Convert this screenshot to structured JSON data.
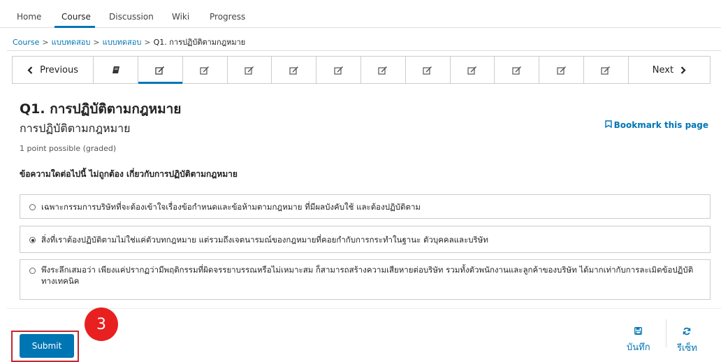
{
  "topnav": {
    "items": [
      {
        "label": "Home",
        "active": false
      },
      {
        "label": "Course",
        "active": true
      },
      {
        "label": "Discussion",
        "active": false
      },
      {
        "label": "Wiki",
        "active": false
      },
      {
        "label": "Progress",
        "active": false
      }
    ]
  },
  "breadcrumb": {
    "items": [
      "Course",
      "แบบทดสอบ",
      "แบบทดสอบ",
      "Q1. การปฏิบัติตามกฎหมาย"
    ],
    "separator": ">"
  },
  "sequence": {
    "previous_label": "Previous",
    "next_label": "Next",
    "tabs": [
      {
        "icon": "book-icon",
        "active": false
      },
      {
        "icon": "edit-icon",
        "active": true
      },
      {
        "icon": "edit-icon",
        "active": false
      },
      {
        "icon": "edit-icon",
        "active": false
      },
      {
        "icon": "edit-icon",
        "active": false
      },
      {
        "icon": "edit-icon",
        "active": false
      },
      {
        "icon": "edit-icon",
        "active": false
      },
      {
        "icon": "edit-icon",
        "active": false
      },
      {
        "icon": "edit-icon",
        "active": false
      },
      {
        "icon": "edit-icon",
        "active": false
      },
      {
        "icon": "edit-icon",
        "active": false
      },
      {
        "icon": "edit-icon",
        "active": false
      }
    ]
  },
  "problem": {
    "title": "Q1. การปฏิบัติตามกฎหมาย",
    "subtitle": "การปฏิบัติตามกฎหมาย",
    "bookmark_label": "Bookmark this page",
    "points": "1 point possible (graded)",
    "question": "ข้อความใดต่อไปนี้ ไม่ถูกต้อง เกี่ยวกับการปฏิบัติตามกฎหมาย",
    "options": [
      {
        "text": "เฉพาะกรรมการบริษัทที่จะต้องเข้าใจเรื่องข้อกำหนดและข้อห้ามตามกฎหมาย ที่มีผลบังคับใช้ และต้องปฏิบัติตาม",
        "selected": false
      },
      {
        "text": "สิ่งที่เราต้องปฏิบัติตามไม่ใช่แค่ตัวบทกฎหมาย แต่รวมถึงเจตนารมณ์ของกฎหมายที่คอยกำกับการกระทำในฐานะ ตัวบุคคลและบริษัท",
        "selected": true
      },
      {
        "text": "พึงระลึกเสมอว่า เพียงแค่ปรากฏว่ามีพฤติกรรมที่ผิดจรรยาบรรณหรือไม่เหมาะสม ก็สามารถสร้างความเสียหายต่อบริษัท รวมทั้งตัวพนักงานและลูกค้าของบริษัท ได้มากเท่ากับการละเมิดข้อปฏิบัติทางเทคนิค",
        "selected": false
      }
    ]
  },
  "actions": {
    "submit_label": "Submit",
    "save_label": "บันทึก",
    "reset_label": "รีเซ็ท"
  },
  "annotation": {
    "step_number": "3",
    "color": "#e8201f"
  },
  "colors": {
    "accent": "#0075b4",
    "highlight_border": "#c0272d"
  }
}
